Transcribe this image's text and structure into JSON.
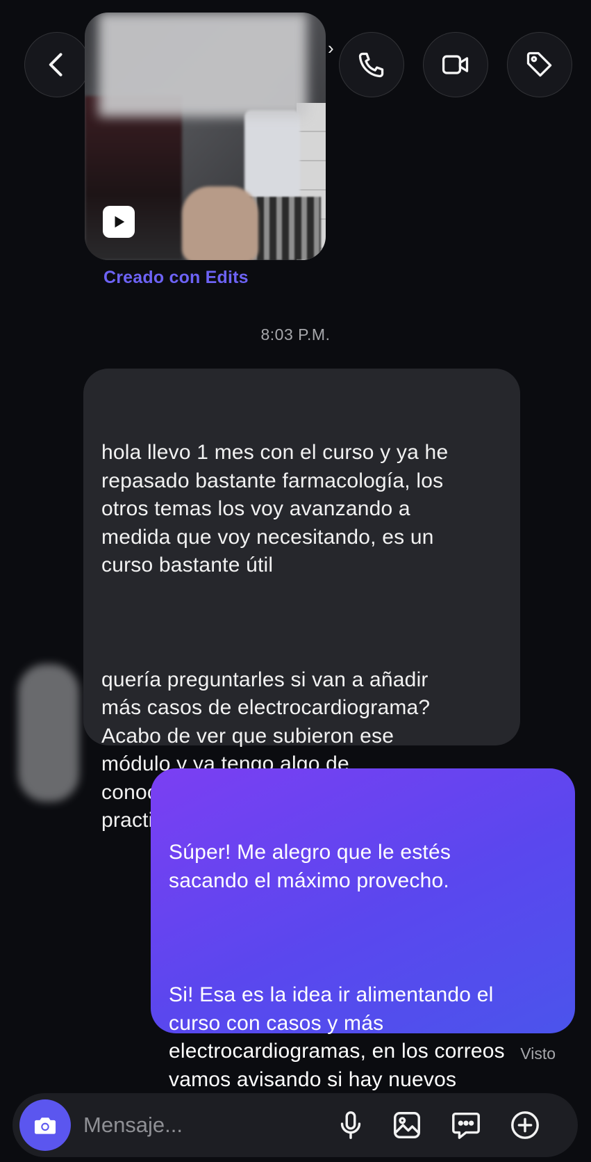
{
  "header": {
    "back_icon": "chevron-left-icon",
    "call_icon": "phone-icon",
    "video_icon": "video-camera-icon",
    "tag_icon": "tag-icon"
  },
  "media": {
    "play_icon": "reels-play-icon",
    "caption": "Creado con Edits"
  },
  "timestamp": "8:03 P.M.",
  "messages": [
    {
      "direction": "incoming",
      "paragraphs": [
        "hola llevo 1 mes con el curso y ya he\nrepasado bastante farmacología, los\notros temas los voy avanzando a\nmedida que voy necesitando, es un\ncurso bastante útil",
        "quería preguntarles si van a añadir\nmás casos de electrocardiograma?\nAcabo de ver que subieron ese\nmódulo y ya tengo algo de\nconocimiento pero me falta\npracticar"
      ]
    },
    {
      "direction": "outgoing",
      "paragraphs": [
        "Súper! Me alegro que le estés\nsacando el máximo provecho.",
        "Si! Esa es la idea ir alimentando el\ncurso con casos y más\nelectrocardiogramas, en los correos\nvamos avisando si hay nuevos\ncasos y actualizaciones (:"
      ]
    }
  ],
  "seen_label": "Visto",
  "composer": {
    "placeholder": "Mensaje...",
    "camera_icon": "camera-icon",
    "mic_icon": "microphone-icon",
    "gallery_icon": "gallery-icon",
    "sticker_icon": "sticker-chat-icon",
    "plus_icon": "plus-circle-icon"
  },
  "colors": {
    "background": "#0b0c10",
    "incoming_bubble": "#26272c",
    "outgoing_bubble_start": "#7b3ff3",
    "outgoing_bubble_end": "#4b54ec",
    "accent": "#5b56ef",
    "link": "#6d63f5",
    "muted_text": "#a6a7ab"
  }
}
